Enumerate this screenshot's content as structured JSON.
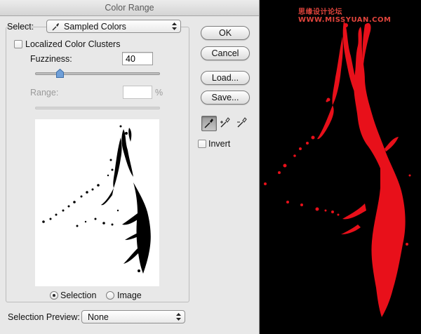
{
  "window": {
    "title": "Color Range"
  },
  "watermark": {
    "text": "思缘设计论坛 WWW.MISSYUAN.COM"
  },
  "select": {
    "label": "Select:",
    "value": "Sampled Colors"
  },
  "localized": {
    "label": "Localized Color Clusters",
    "checked": false
  },
  "fuzziness": {
    "label": "Fuzziness:",
    "value": "40",
    "slider_fraction": 0.2
  },
  "range": {
    "label": "Range:",
    "value": "",
    "unit": "%",
    "enabled": false
  },
  "buttons": {
    "ok": "OK",
    "cancel": "Cancel",
    "load": "Load...",
    "save": "Save..."
  },
  "tools": [
    {
      "icon": "eyedropper-icon",
      "active": true
    },
    {
      "icon": "eyedropper-plus-icon",
      "active": false
    },
    {
      "icon": "eyedropper-minus-icon",
      "active": false
    }
  ],
  "invert": {
    "label": "Invert",
    "checked": false
  },
  "preview_mode": {
    "options": [
      "Selection",
      "Image"
    ],
    "selected": "Selection"
  },
  "selection_preview": {
    "label": "Selection Preview:",
    "value": "None"
  },
  "colors": {
    "accent": "#6f9fd8",
    "splash": "#e8101a",
    "dialog_bg": "#e8e8e8"
  }
}
